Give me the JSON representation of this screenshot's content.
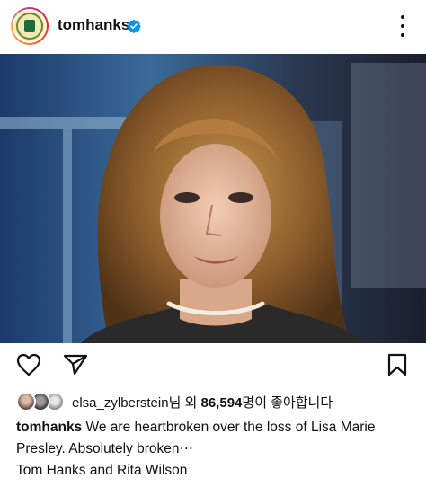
{
  "post": {
    "username": "tomhanks",
    "verified": true,
    "liked_by_user": "elsa_zylberstein",
    "liked_by_suffix": "님 외 ",
    "likes_count": "86,594",
    "likes_suffix": "명이 좋아합니다",
    "caption_username": "tomhanks",
    "caption_text": "We are heartbroken over the loss of Lisa Marie Presley. Absolutely broken⋯",
    "caption_signature": "Tom Hanks and Rita Wilson"
  },
  "icons": {
    "more": "more-vertical-icon",
    "verified": "verified-badge-icon",
    "like": "heart-icon",
    "share": "send-icon",
    "save": "bookmark-icon"
  },
  "colors": {
    "verified_blue": "#0095f6",
    "text": "#111111",
    "background": "#ffffff"
  }
}
